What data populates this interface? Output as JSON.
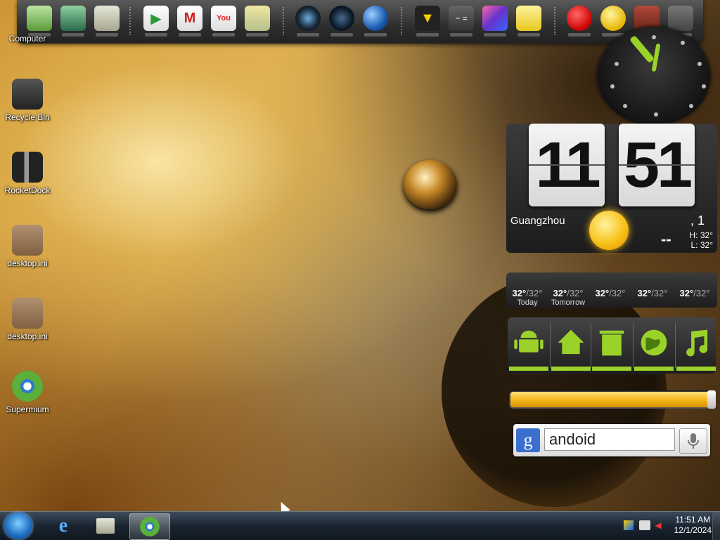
{
  "desktop_icons": [
    {
      "label": "Computer",
      "icon": "computer-icon"
    },
    {
      "label": "Recycle Bin",
      "icon": "recycle-bin-icon"
    },
    {
      "label": "RocketDock",
      "icon": "rocketdock-icon"
    },
    {
      "label": "desktop.ini",
      "icon": "config-file-icon"
    },
    {
      "label": "desktop.ini",
      "icon": "config-file-icon"
    },
    {
      "label": "Supermium",
      "icon": "browser-icon"
    }
  ],
  "dock_items": [
    "computer-icon",
    "network-icon",
    "android-folder-icon",
    "play-store-icon",
    "gmail-icon",
    "youtube-icon",
    "maps-icon",
    "camera-icon",
    "speaker-icon",
    "globe-icon",
    "media-icon",
    "calculator-icon",
    "gallery-icon",
    "notes-icon",
    "angry-birds-icon",
    "weather-icon",
    "android-robot-icon",
    "trash-icon"
  ],
  "clock_widget": {
    "hour": "11",
    "minute": "51",
    "city": "Guangzhou",
    "day_num": ", 1",
    "current_temp": "--",
    "high": "H: 32°",
    "low": "L: 32°"
  },
  "forecast": [
    {
      "hi": "32°",
      "lo": "/32°",
      "day": "Today"
    },
    {
      "hi": "32°",
      "lo": "/32°",
      "day": "Tomorrow"
    },
    {
      "hi": "32°",
      "lo": "/32°",
      "day": ""
    },
    {
      "hi": "32°",
      "lo": "/32°",
      "day": ""
    },
    {
      "hi": "32°",
      "lo": "/32°",
      "day": ""
    }
  ],
  "shortcuts": [
    "android-icon",
    "home-icon",
    "trash-icon",
    "globe-icon",
    "music-icon"
  ],
  "battery_level": 0.98,
  "search": {
    "logo": "g",
    "value": "andoid"
  },
  "taskbar": {
    "pinned": [
      "internet-explorer-icon",
      "android-folder-icon",
      "browser-icon"
    ],
    "time": "11:51 AM",
    "date": "12/1/2024"
  },
  "colors": {
    "accent_green": "#9bd22a",
    "sun": "#f2b418",
    "start_blue": "#1c6cc0"
  }
}
